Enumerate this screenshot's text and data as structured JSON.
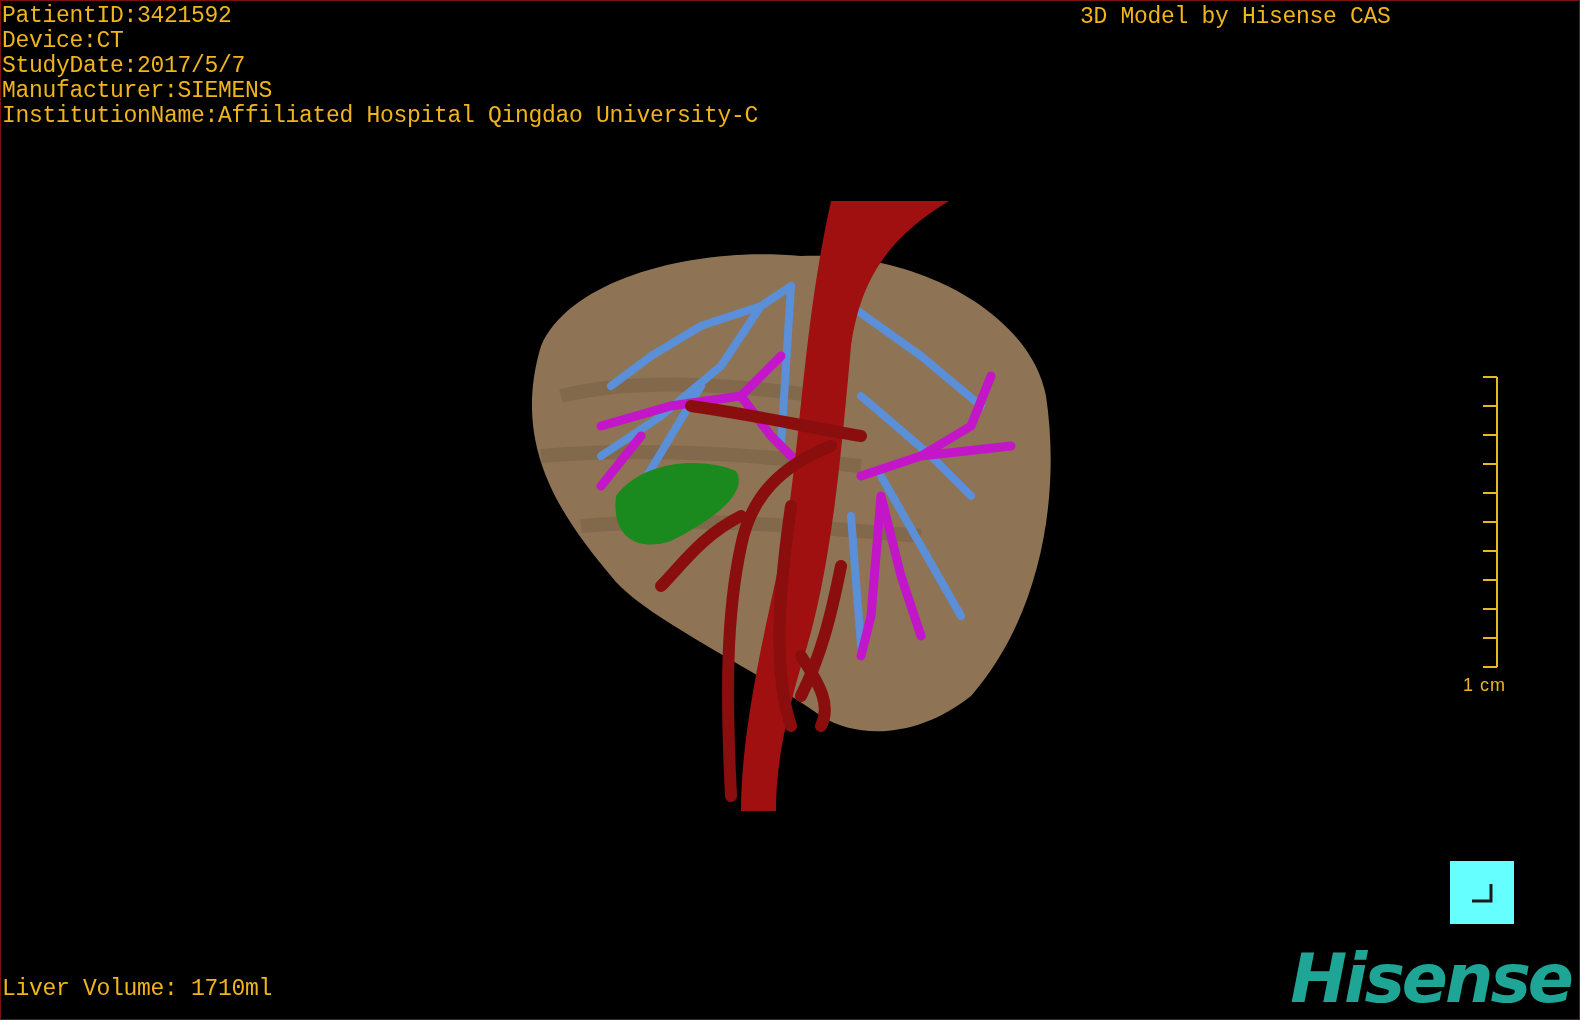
{
  "info_lines": [
    "PatientID:3421592",
    "Device:CT",
    "StudyDate:2017/5/7",
    "Manufacturer:SIEMENS",
    "InstitutionName:Affiliated Hospital Qingdao University-C"
  ],
  "title": "3D Model by Hisense CAS",
  "scale_bar": {
    "label": "1 cm"
  },
  "liver_volume": "Liver Volume: 1710ml",
  "logo": "Hisense"
}
